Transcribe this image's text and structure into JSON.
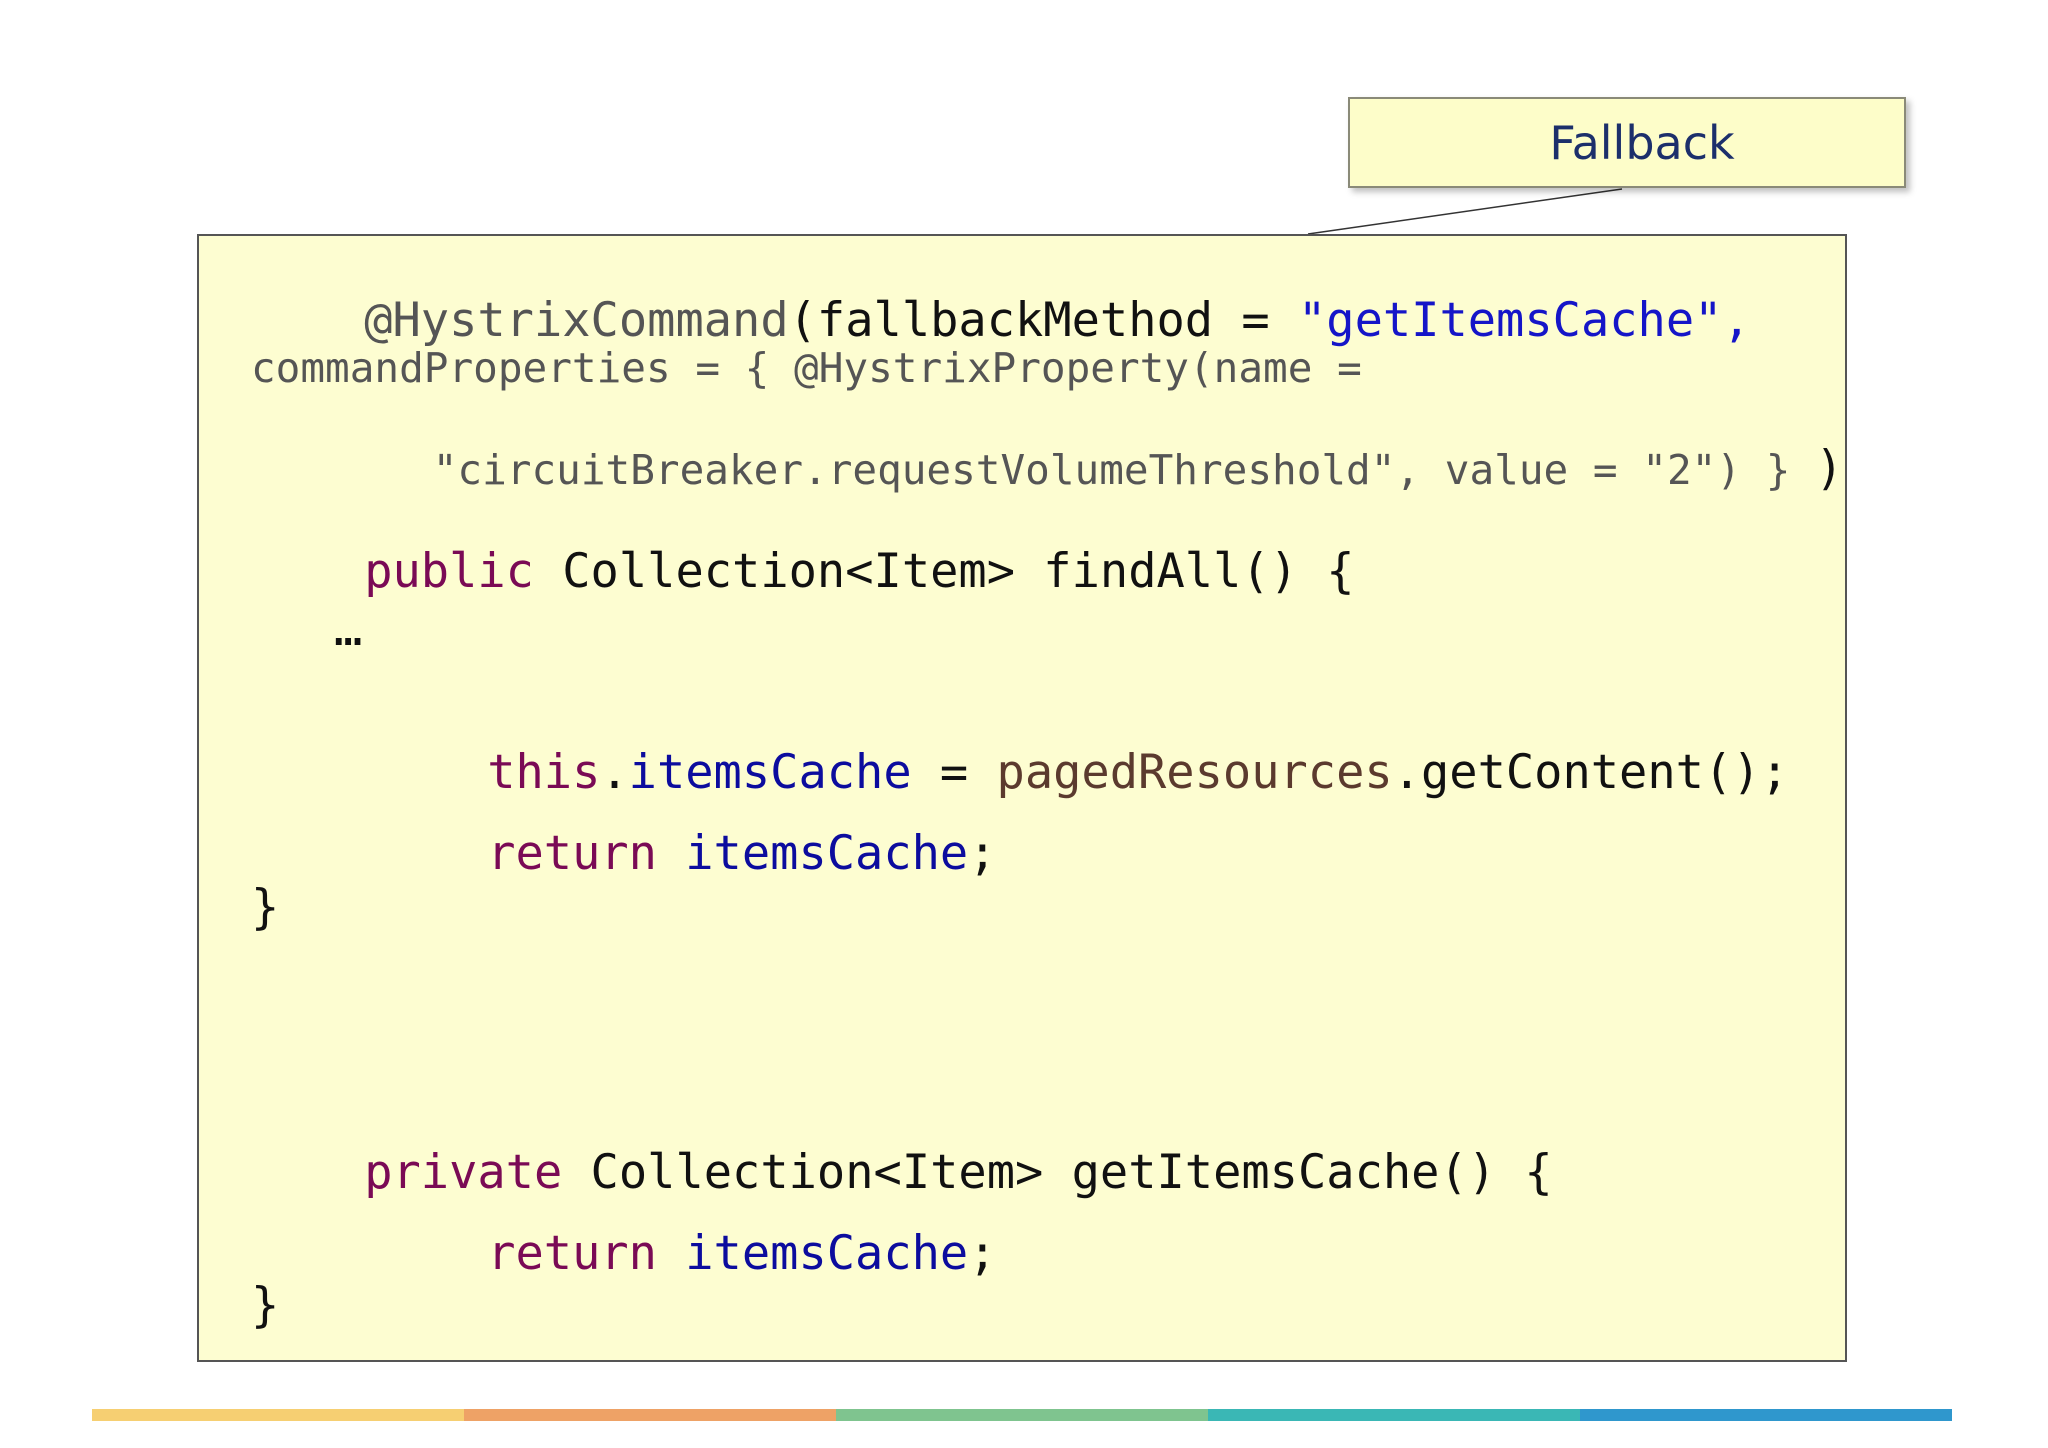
{
  "callout": {
    "label": "Fallback"
  },
  "code": {
    "l1_annotation": "@HystrixCommand",
    "l1_mid": "(fallbackMethod = ",
    "l1_string": "\"getItemsCache\",",
    "l2": "commandProperties = { @HystrixProperty(name =",
    "l3_main": "\"circuitBreaker.requestVolumeThreshold\", value = \"2\") } ",
    "l3_paren": ")",
    "l4_keyword": "public",
    "l4_rest": " Collection<Item> findAll() {",
    "l5_ellipsis": "…",
    "l6_this": "this",
    "l6_dot": ".",
    "l6_field": "itemsCache",
    "l6_eq": " = ",
    "l6_var": "pagedResources",
    "l6_call": ".getContent();",
    "l7_keyword": "return",
    "l7_space": " ",
    "l7_field": "itemsCache",
    "l7_semi": ";",
    "l8_brace": "}",
    "l9_keyword": "private",
    "l9_rest": " Collection<Item> getItemsCache() {",
    "l10_keyword": "return",
    "l10_space": " ",
    "l10_field": "itemsCache",
    "l10_semi": ";",
    "l11_brace": "}"
  },
  "colors": {
    "bar": [
      "#f6cf72",
      "#eea266",
      "#7fc48f",
      "#3ab7b5",
      "#2f97cd"
    ]
  }
}
